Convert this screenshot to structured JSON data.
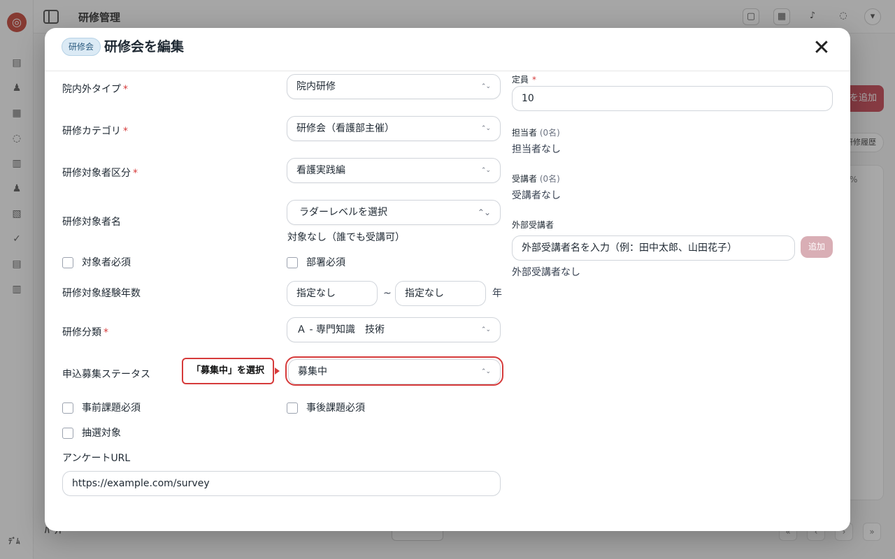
{
  "background": {
    "page_title": "研修管理",
    "add_button": "を追加",
    "pill": "研修履歴",
    "card_text": "%",
    "footer_text": "ﾊﾟｯﾄ",
    "user_initials": "ﾃﾞﾑ"
  },
  "modal": {
    "badge": "研修会",
    "title": "研修会を編集",
    "close_icon": "close-icon"
  },
  "form": {
    "location_type": {
      "label": "院内外タイプ",
      "required": "*",
      "value": "院内研修"
    },
    "category": {
      "label": "研修カテゴリ",
      "required": "*",
      "value": "研修会（看護部主催）"
    },
    "target_division": {
      "label": "研修対象者区分",
      "required": "*",
      "value": "看護実践編"
    },
    "target_name": {
      "label": "研修対象者名",
      "placeholder": "ラダーレベルを選択",
      "note": "対象なし（誰でも受講可）"
    },
    "target_required": {
      "label": "対象者必須"
    },
    "dept_required": {
      "label": "部署必須"
    },
    "experience_years": {
      "label": "研修対象経験年数",
      "from": "指定なし",
      "separator": "~",
      "to": "指定なし",
      "unit": "年"
    },
    "classification": {
      "label": "研修分類",
      "required": "*",
      "value": "Ａ - 専門知識　技術"
    },
    "recruit_status": {
      "label": "申込募集ステータス",
      "value": "募集中"
    },
    "pre_task": {
      "label": "事前課題必須"
    },
    "post_task": {
      "label": "事後課題必須"
    },
    "lottery": {
      "label": "抽選対象"
    },
    "survey_url": {
      "label": "アンケートURL",
      "value": "https://example.com/survey"
    }
  },
  "right": {
    "capacity": {
      "label": "定員",
      "required": "*",
      "value": "10"
    },
    "staff": {
      "label": "担当者",
      "count": "(0名)",
      "empty": "担当者なし"
    },
    "attendees": {
      "label": "受講者",
      "count": "(0名)",
      "empty": "受講者なし"
    },
    "external": {
      "label": "外部受講者",
      "placeholder": "外部受講者名を入力（例：田中太郎、山田花子）",
      "add_button": "追加",
      "empty": "外部受講者なし"
    }
  },
  "callout": {
    "text": "「募集中」を選択"
  },
  "colors": {
    "accent_red": "#d63b3b",
    "badge_bg": "#dbeaf5",
    "add_button_bg": "#d9aeb5"
  }
}
